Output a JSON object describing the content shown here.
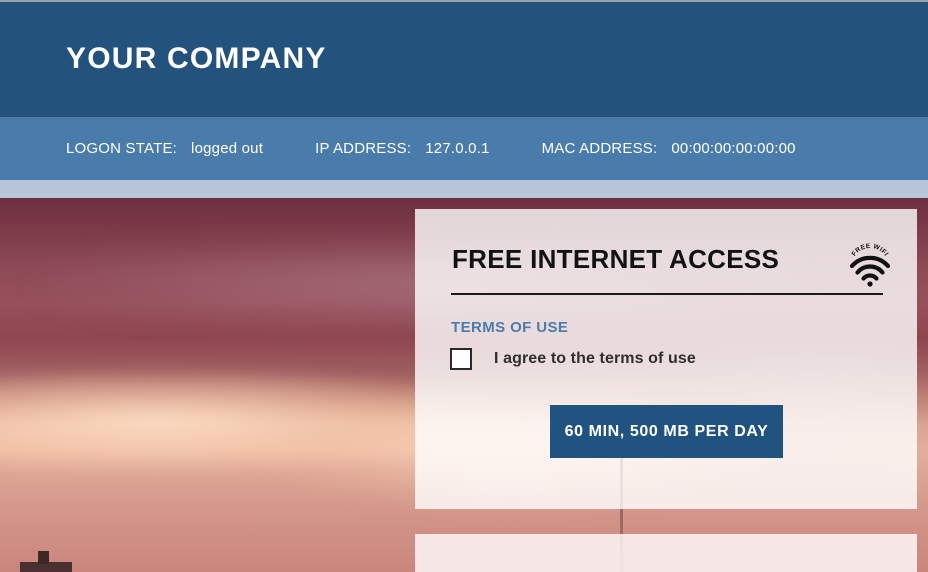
{
  "header": {
    "company_title": "YOUR COMPANY",
    "background_color": "#23527c"
  },
  "statusbar": {
    "background_color": "#4a7cab",
    "items": [
      {
        "label": "LOGON STATE:",
        "value": "logged out"
      },
      {
        "label": "IP ADDRESS:",
        "value": "127.0.0.1"
      },
      {
        "label": "MAC ADDRESS:",
        "value": "00:00:00:00:00:00"
      }
    ]
  },
  "card": {
    "title": "FREE INTERNET ACCESS",
    "wifi_badge_text": "FREE WIFI",
    "terms_link": "TERMS OF USE",
    "agree_label": "I agree to the terms of use",
    "agree_checked": false,
    "button_label": "60 MIN, 500 MB PER DAY",
    "button_color": "#215381",
    "link_color": "#4a7cab"
  }
}
